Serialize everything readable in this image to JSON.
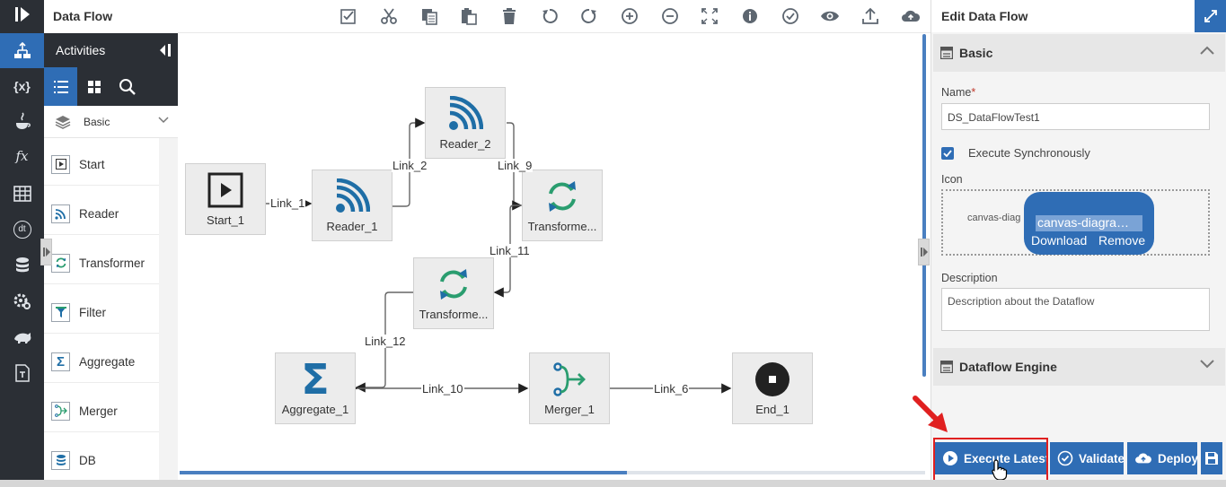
{
  "header": {
    "title": "Data Flow"
  },
  "toolbar": {
    "items": [
      "select-all-icon",
      "cut-icon",
      "copy-icon",
      "paste-icon",
      "delete-icon",
      "undo-icon",
      "redo-icon",
      "zoom-in-icon",
      "zoom-out-icon",
      "fit-screen-icon",
      "info-icon",
      "validate-check-icon",
      "preview-eye-icon",
      "upload-icon",
      "cloud-deploy-icon"
    ]
  },
  "rail": {
    "items": [
      "play-logo-icon",
      "dataflow-icon",
      "variables-icon",
      "java-icon",
      "function-fx-icon",
      "table-icon",
      "dt-icon",
      "database-icon",
      "settings-icon",
      "hadoop-icon",
      "template-icon"
    ],
    "variables_label": "{x}",
    "fx_label": "fx",
    "dt_label": "dt"
  },
  "palette": {
    "title": "Activities",
    "category": "Basic",
    "items": [
      {
        "label": "Start",
        "icon": "start-icon"
      },
      {
        "label": "Reader",
        "icon": "reader-icon"
      },
      {
        "label": "Transformer",
        "icon": "transformer-icon"
      },
      {
        "label": "Filter",
        "icon": "filter-icon"
      },
      {
        "label": "Aggregate",
        "icon": "aggregate-icon"
      },
      {
        "label": "Merger",
        "icon": "merger-icon"
      },
      {
        "label": "DB",
        "icon": "db-icon"
      }
    ]
  },
  "canvas": {
    "nodes": {
      "start_1": "Start_1",
      "reader_1": "Reader_1",
      "reader_2": "Reader_2",
      "transformer_a": "Transforme...",
      "transformer_b": "Transforme...",
      "aggregate_1": "Aggregate_1",
      "merger_1": "Merger_1",
      "end_1": "End_1"
    },
    "links": {
      "link_1": "Link_1",
      "link_2": "Link_2",
      "link_9": "Link_9",
      "link_11": "Link_11",
      "link_12": "Link_12",
      "link_10": "Link_10",
      "link_6": "Link_6"
    }
  },
  "panel": {
    "title": "Edit Data Flow",
    "basic_section": "Basic",
    "name_label": "Name",
    "required_mark": "*",
    "name_value": "DS_DataFlowTest1",
    "execute_sync_label": "Execute Synchronously",
    "execute_sync_checked": true,
    "icon_label": "Icon",
    "icon_caption": "canvas-diag",
    "icon_popup_name": "canvas-diagra…",
    "icon_download": "Download",
    "icon_remove": "Remove",
    "description_label": "Description",
    "description_placeholder": "Description about the Dataflow",
    "engine_section": "Dataflow Engine"
  },
  "actions": {
    "execute_latest": "Execute Latest",
    "validate": "Validate",
    "deploy": "Deploy"
  },
  "colors": {
    "accent": "#2f6db5",
    "rail": "#2b2f35",
    "reader_icon": "#1f6ea6",
    "transformer_icon": "#2a9d6f",
    "highlight": "#e02020"
  }
}
